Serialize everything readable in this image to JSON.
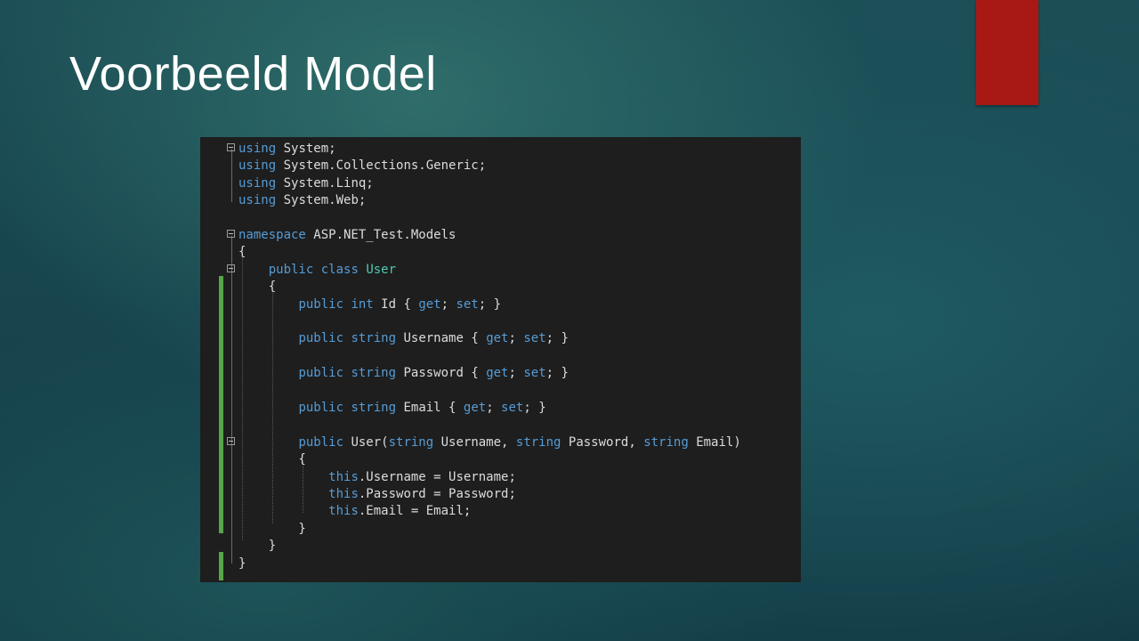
{
  "slide": {
    "title": "Voorbeeld Model",
    "accent_color": "#a81915"
  },
  "editor": {
    "language": "C#",
    "theme": "dark",
    "colors": {
      "keyword": "#569cd6",
      "type": "#4ec9b0",
      "text": "#dcdcdc",
      "background": "#1e1e1e",
      "change_marker": "#57a64a"
    },
    "lines": [
      {
        "segments": [
          {
            "t": "using",
            "k": "kw"
          },
          {
            "t": " System;"
          }
        ]
      },
      {
        "segments": [
          {
            "t": "using",
            "k": "kw"
          },
          {
            "t": " System.Collections.Generic;"
          }
        ]
      },
      {
        "segments": [
          {
            "t": "using",
            "k": "kw"
          },
          {
            "t": " System.Linq;"
          }
        ]
      },
      {
        "segments": [
          {
            "t": "using",
            "k": "kw"
          },
          {
            "t": " System.Web;"
          }
        ]
      },
      {
        "segments": []
      },
      {
        "segments": [
          {
            "t": "namespace",
            "k": "kw"
          },
          {
            "t": " ASP.NET_Test.Models"
          }
        ]
      },
      {
        "segments": [
          {
            "t": "{"
          }
        ]
      },
      {
        "segments": [
          {
            "t": "    "
          },
          {
            "t": "public",
            "k": "kw"
          },
          {
            "t": " "
          },
          {
            "t": "class",
            "k": "kw"
          },
          {
            "t": " "
          },
          {
            "t": "User",
            "k": "ty"
          }
        ]
      },
      {
        "segments": [
          {
            "t": "    {"
          }
        ]
      },
      {
        "segments": [
          {
            "t": "        "
          },
          {
            "t": "public",
            "k": "kw"
          },
          {
            "t": " "
          },
          {
            "t": "int",
            "k": "kw"
          },
          {
            "t": " Id { "
          },
          {
            "t": "get",
            "k": "kw"
          },
          {
            "t": "; "
          },
          {
            "t": "set",
            "k": "kw"
          },
          {
            "t": "; }"
          }
        ]
      },
      {
        "segments": []
      },
      {
        "segments": [
          {
            "t": "        "
          },
          {
            "t": "public",
            "k": "kw"
          },
          {
            "t": " "
          },
          {
            "t": "string",
            "k": "kw"
          },
          {
            "t": " Username { "
          },
          {
            "t": "get",
            "k": "kw"
          },
          {
            "t": "; "
          },
          {
            "t": "set",
            "k": "kw"
          },
          {
            "t": "; }"
          }
        ]
      },
      {
        "segments": []
      },
      {
        "segments": [
          {
            "t": "        "
          },
          {
            "t": "public",
            "k": "kw"
          },
          {
            "t": " "
          },
          {
            "t": "string",
            "k": "kw"
          },
          {
            "t": " Password { "
          },
          {
            "t": "get",
            "k": "kw"
          },
          {
            "t": "; "
          },
          {
            "t": "set",
            "k": "kw"
          },
          {
            "t": "; }"
          }
        ]
      },
      {
        "segments": []
      },
      {
        "segments": [
          {
            "t": "        "
          },
          {
            "t": "public",
            "k": "kw"
          },
          {
            "t": " "
          },
          {
            "t": "string",
            "k": "kw"
          },
          {
            "t": " Email { "
          },
          {
            "t": "get",
            "k": "kw"
          },
          {
            "t": "; "
          },
          {
            "t": "set",
            "k": "kw"
          },
          {
            "t": "; }"
          }
        ]
      },
      {
        "segments": []
      },
      {
        "segments": [
          {
            "t": "        "
          },
          {
            "t": "public",
            "k": "kw"
          },
          {
            "t": " User("
          },
          {
            "t": "string",
            "k": "kw"
          },
          {
            "t": " Username, "
          },
          {
            "t": "string",
            "k": "kw"
          },
          {
            "t": " Password, "
          },
          {
            "t": "string",
            "k": "kw"
          },
          {
            "t": " Email)"
          }
        ]
      },
      {
        "segments": [
          {
            "t": "        {"
          }
        ]
      },
      {
        "segments": [
          {
            "t": "            "
          },
          {
            "t": "this",
            "k": "kw"
          },
          {
            "t": ".Username = Username;"
          }
        ]
      },
      {
        "segments": [
          {
            "t": "            "
          },
          {
            "t": "this",
            "k": "kw"
          },
          {
            "t": ".Password = Password;"
          }
        ]
      },
      {
        "segments": [
          {
            "t": "            "
          },
          {
            "t": "this",
            "k": "kw"
          },
          {
            "t": ".Email = Email;"
          }
        ]
      },
      {
        "segments": [
          {
            "t": "        }"
          }
        ]
      },
      {
        "segments": [
          {
            "t": "    }"
          }
        ]
      },
      {
        "segments": [
          {
            "t": "}"
          }
        ]
      }
    ]
  }
}
